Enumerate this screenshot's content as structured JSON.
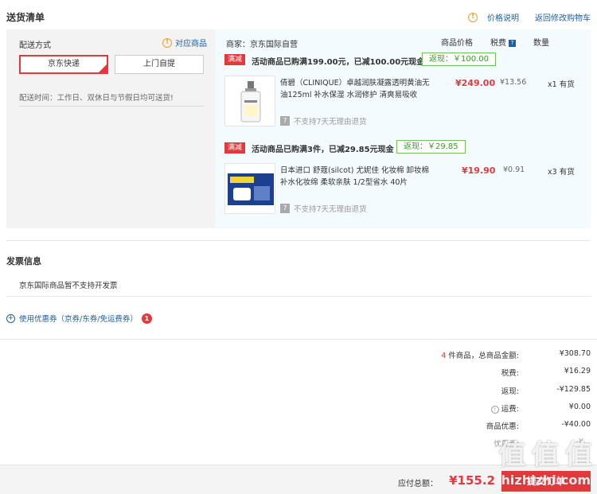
{
  "header": {
    "title": "送货清单",
    "price_info_link": "价格说明",
    "back_cart_link": "返回修改购物车"
  },
  "shipping": {
    "label": "配送方式",
    "match_link": "对应商品",
    "options": [
      "京东快递",
      "上门自提"
    ],
    "selected": "京东快递",
    "time_label": "配送时间：工作日、双休日与节假日均可送货!"
  },
  "store": {
    "seller_label": "商家：京东国际自营",
    "columns": [
      "商品价格",
      "税费",
      "数量"
    ]
  },
  "groups": [
    {
      "promo_tag": "满减",
      "promo_text": "活动商品已购满199.00元，已减100.00元现金",
      "refund": "返现：￥100.00",
      "item": {
        "name": "倩碧（CLINIQUE）卓越润肤凝露透明黄油无油125ml 补水保湿 水润修护 清爽易吸收",
        "price": "¥249.00",
        "tax": "¥13.56",
        "qty": "x1",
        "stock": "有货",
        "return_note": "不支持7天无理由退货"
      }
    },
    {
      "promo_tag": "满减",
      "promo_text": "活动商品已购满3件，已减29.85元现金",
      "refund": "返现：￥29.85",
      "item": {
        "name": "日本进口 舒蔻(silcot) 尤妮佳 化妆棉 卸妆棉 补水化妆绵 柔软亲肤 1/2型省水 40片",
        "price": "¥19.90",
        "tax": "¥0.91",
        "qty": "x3",
        "stock": "有货",
        "return_note": "不支持7天无理由退货"
      }
    }
  ],
  "invoice": {
    "title": "发票信息",
    "text": "京东国际商品暂不支持开发票"
  },
  "coupon": {
    "label": "使用优惠券（京券/东券/免运费券）",
    "count": "1"
  },
  "summary": {
    "count": "4",
    "count_suffix": "件商品，总商品金额:",
    "subtotal": "¥308.70",
    "tax_label": "税费:",
    "tax": "¥16.29",
    "refund_label": "返现:",
    "refund": "-¥129.85",
    "shipping_label": "运费:",
    "shipping": "¥0.00",
    "discount_label": "商品优惠:",
    "discount": "-¥40.00",
    "extra_label": "优惠券:",
    "extra": "-¥..."
  },
  "footer": {
    "total_label": "应付总额：",
    "total": "¥155.2",
    "submit": "提交订单"
  },
  "watermark": {
    "logo": "值 值 值",
    "site": "hizhizhi.com"
  },
  "colors": {
    "accent_red": "#e4393c",
    "link_blue": "#1f5ea8",
    "refund_green": "#3a9b2a"
  }
}
